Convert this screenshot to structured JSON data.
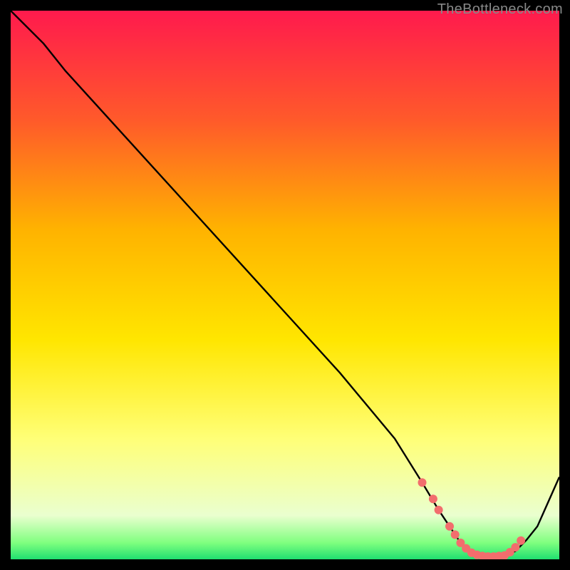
{
  "watermark": "TheBottleneck.com",
  "chart_data": {
    "type": "line",
    "title": "",
    "xlabel": "",
    "ylabel": "",
    "xlim": [
      0,
      100
    ],
    "ylim": [
      0,
      100
    ],
    "gradient_stops": [
      {
        "offset": 0.0,
        "color": "#ff1a4d"
      },
      {
        "offset": 0.2,
        "color": "#ff5a2a"
      },
      {
        "offset": 0.4,
        "color": "#ffb300"
      },
      {
        "offset": 0.6,
        "color": "#ffe600"
      },
      {
        "offset": 0.78,
        "color": "#ffff77"
      },
      {
        "offset": 0.92,
        "color": "#eaffcf"
      },
      {
        "offset": 0.97,
        "color": "#7fff7f"
      },
      {
        "offset": 1.0,
        "color": "#20e070"
      }
    ],
    "series": [
      {
        "name": "bottleneck-curve",
        "x": [
          0,
          6,
          10,
          20,
          30,
          40,
          50,
          60,
          70,
          75,
          78,
          80,
          82,
          84,
          86,
          88,
          90,
          92,
          94,
          96,
          100
        ],
        "y": [
          100,
          94,
          89,
          78,
          67,
          56,
          45,
          34,
          22,
          14,
          9,
          6,
          3,
          1,
          0.5,
          0.5,
          0.6,
          1.5,
          3.5,
          6,
          15
        ]
      }
    ],
    "markers": {
      "name": "highlight-points",
      "color": "#f26d6d",
      "radius": 6,
      "x": [
        75,
        77,
        78,
        80,
        81,
        82,
        83,
        84,
        85,
        86,
        87,
        88,
        89,
        90,
        91,
        92,
        93
      ],
      "y": [
        14,
        11,
        9,
        6,
        4.5,
        3,
        2,
        1.2,
        0.8,
        0.6,
        0.5,
        0.5,
        0.6,
        0.7,
        1.3,
        2.2,
        3.4
      ]
    }
  }
}
